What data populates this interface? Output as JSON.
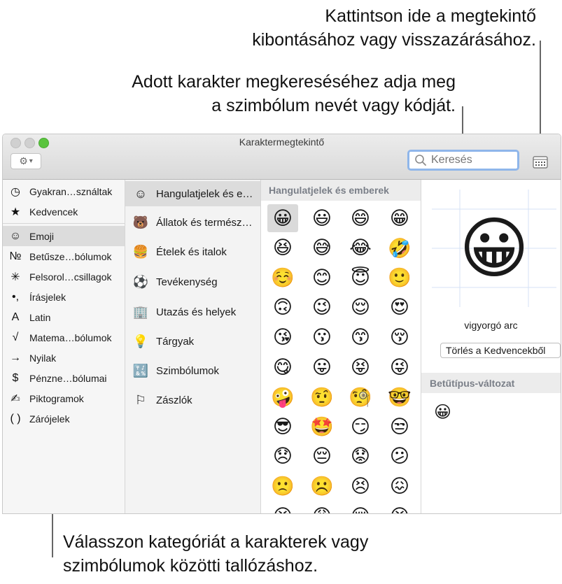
{
  "callouts": {
    "top": [
      "Kattintson ide a megtekintő",
      "kibontásához vagy visszazárásához."
    ],
    "mid": [
      "Adott karakter megkereséséhez adja meg",
      "a szimbólum nevét vagy kódját."
    ],
    "bottom": [
      "Válasszon kategóriát a karakterek vagy",
      "szimbólumok közötti tallózáshoz."
    ]
  },
  "window": {
    "title": "Karaktermegtekintő",
    "search_placeholder": "Keresés"
  },
  "sidebar": {
    "items": [
      {
        "label": "Gyakran…sználtak",
        "icon": "◷",
        "icon_name": "clock-icon"
      },
      {
        "label": "Kedvencek",
        "icon": "★",
        "icon_name": "star-icon"
      },
      {
        "label": "Emoji",
        "icon": "☺",
        "icon_name": "smiley-icon",
        "selected": true
      },
      {
        "label": "Betűsze…bólumok",
        "icon": "№",
        "icon_name": "numero-icon"
      },
      {
        "label": "Felsorol…csillagok",
        "icon": "✳",
        "icon_name": "asterisk-icon"
      },
      {
        "label": "Írásjelek",
        "icon": "•,",
        "icon_name": "punctuation-icon"
      },
      {
        "label": "Latin",
        "icon": "A",
        "icon_name": "latin-letter-icon"
      },
      {
        "label": "Matema…bólumok",
        "icon": "√",
        "icon_name": "square-root-icon"
      },
      {
        "label": "Nyilak",
        "icon": "→",
        "icon_name": "arrow-icon"
      },
      {
        "label": "Pénzne…bólumai",
        "icon": "$",
        "icon_name": "dollar-icon"
      },
      {
        "label": "Piktogramok",
        "icon": "✍",
        "icon_name": "pictograph-icon"
      },
      {
        "label": "Zárójelek",
        "icon": "( )",
        "icon_name": "parentheses-icon"
      }
    ]
  },
  "subcategories": {
    "items": [
      {
        "label": "Hangulatjelek és e…",
        "icon": "☺",
        "icon_name": "smiley-icon",
        "selected": true
      },
      {
        "label": "Állatok és termész…",
        "icon": "🐻",
        "icon_name": "bear-icon"
      },
      {
        "label": "Ételek és italok",
        "icon": "🍔",
        "icon_name": "food-icon"
      },
      {
        "label": "Tevékenység",
        "icon": "⚽",
        "icon_name": "soccer-ball-icon"
      },
      {
        "label": "Utazás és helyek",
        "icon": "🏢",
        "icon_name": "building-icon"
      },
      {
        "label": "Tárgyak",
        "icon": "💡",
        "icon_name": "lightbulb-icon"
      },
      {
        "label": "Szimbólumok",
        "icon": "🔣",
        "icon_name": "symbols-icon"
      },
      {
        "label": "Zászlók",
        "icon": "⚐",
        "icon_name": "flag-icon"
      }
    ]
  },
  "grid": {
    "header": "Hangulatjelek és emberek",
    "emojis": [
      "😀",
      "😃",
      "😄",
      "😁",
      "😆",
      "😅",
      "😂",
      "🤣",
      "☺️",
      "😊",
      "😇",
      "🙂",
      "🙃",
      "😉",
      "😌",
      "😍",
      "😘",
      "😗",
      "😙",
      "😚",
      "😋",
      "😛",
      "😝",
      "😜",
      "🤪",
      "🤨",
      "🧐",
      "🤓",
      "😎",
      "🤩",
      "😏",
      "😒",
      "😞",
      "😔",
      "😟",
      "😕",
      "🙁",
      "☹️",
      "😣",
      "😖",
      "😫",
      "😩",
      "😢",
      "😭"
    ]
  },
  "detail": {
    "preview_emoji": "😀",
    "name": "vigyorgó arc",
    "favorites_button": "Törlés a Kedvencekből",
    "variant_header": "Betűtípus-változat",
    "variant_emoji": "😀"
  }
}
